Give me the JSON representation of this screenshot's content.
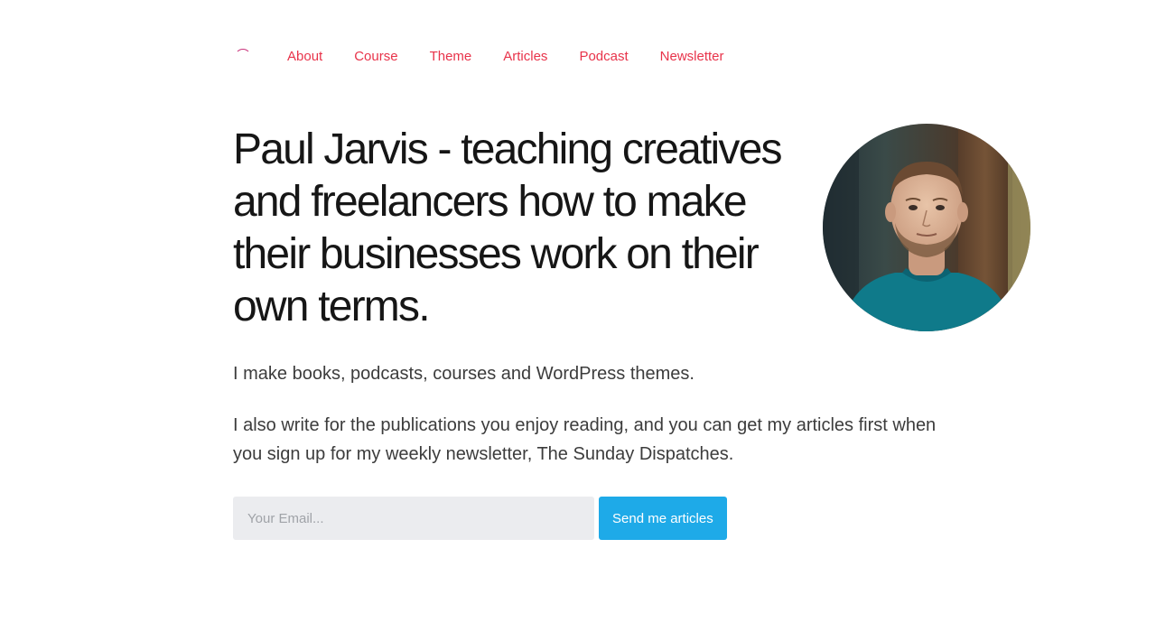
{
  "nav": {
    "items": [
      {
        "label": "About"
      },
      {
        "label": "Course"
      },
      {
        "label": "Theme"
      },
      {
        "label": "Articles"
      },
      {
        "label": "Podcast"
      },
      {
        "label": "Newsletter"
      }
    ]
  },
  "hero": {
    "title": "Paul Jarvis - teaching creatives and freelancers how to make their businesses work on their own terms.",
    "intro_1": "I make books, podcasts, courses and WordPress themes.",
    "intro_2": "I also write for the publications you enjoy reading, and you can get my articles first when you sign up for my weekly newsletter, The Sunday Dispatches."
  },
  "signup": {
    "email_value": "",
    "email_placeholder": "Your Email...",
    "submit_label": "Send me articles"
  },
  "colors": {
    "nav_link": "#e8334a",
    "button": "#1eaae8",
    "input_bg": "#ebecef",
    "logo_arc": "#c9347c"
  },
  "icons": {
    "logo": "logo-arc-icon",
    "avatar": "portrait-photo"
  }
}
